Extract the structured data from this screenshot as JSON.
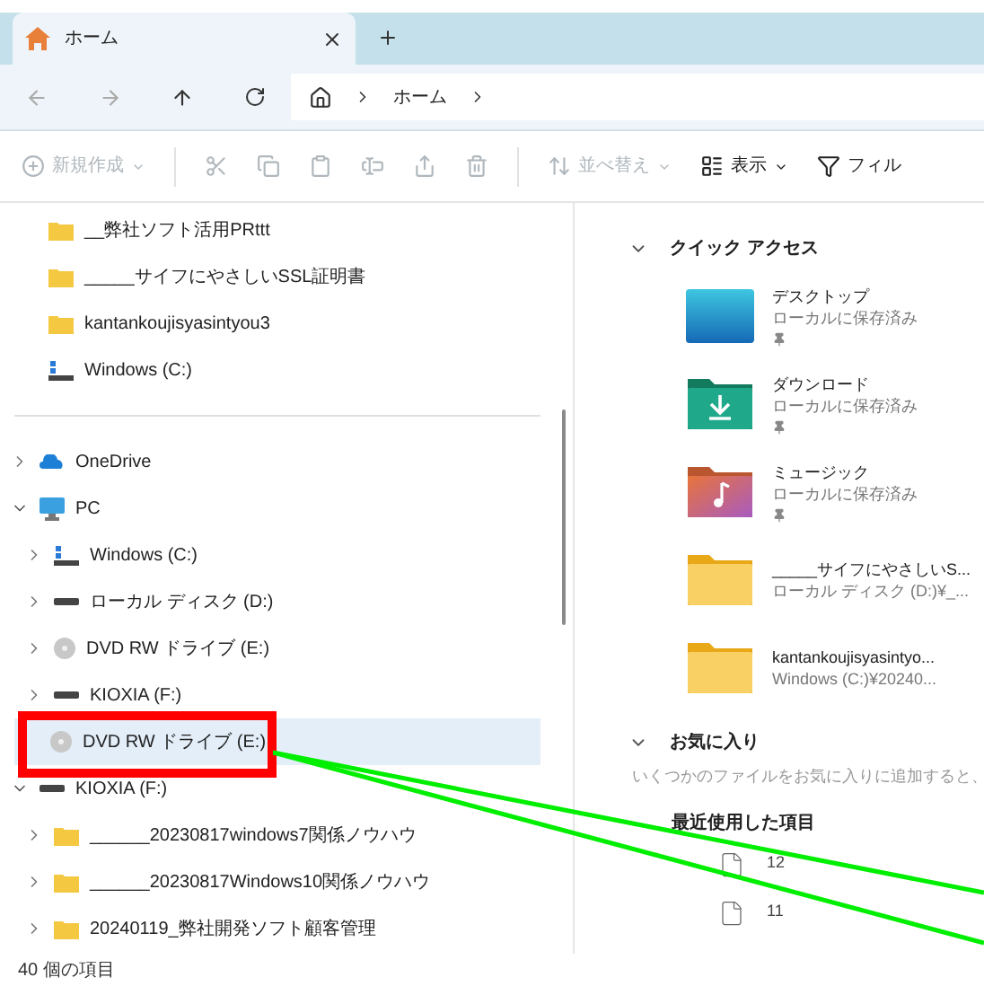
{
  "tabs": [
    {
      "label": "ホーム",
      "selected": true
    }
  ],
  "address": {
    "crumbs": [
      "ホーム"
    ]
  },
  "toolbar": [
    {
      "kind": "new",
      "label": "新規作成",
      "disabled": true
    },
    {
      "kind": "cut",
      "disabled": true
    },
    {
      "kind": "copy",
      "disabled": true
    },
    {
      "kind": "paste",
      "disabled": true
    },
    {
      "kind": "rename",
      "disabled": true
    },
    {
      "kind": "share",
      "disabled": true
    },
    {
      "kind": "delete",
      "disabled": true
    },
    {
      "kind": "sort",
      "label": "並べ替え",
      "disabled": true
    },
    {
      "kind": "view",
      "label": "表示",
      "disabled": false
    },
    {
      "kind": "filter",
      "label": "フィル",
      "disabled": false
    }
  ],
  "nav_pinned": [
    {
      "kind": "folder",
      "label": "__弊社ソフト活用PRttt"
    },
    {
      "kind": "folder",
      "label": "_____サイフにやさしいSSL証明書"
    },
    {
      "kind": "folder",
      "label": "kantankoujisyasintyou3"
    },
    {
      "kind": "windrive",
      "label": "Windows (C:)"
    }
  ],
  "nav_tree": [
    {
      "kind": "cloud",
      "label": "OneDrive",
      "expanded": false,
      "selected": false
    },
    {
      "kind": "pc",
      "label": "PC",
      "expanded": true,
      "selected": false,
      "children": [
        {
          "kind": "windrive",
          "label": "Windows (C:)",
          "expanded": false,
          "selected": false
        },
        {
          "kind": "disk",
          "label": "ローカル ディスク (D:)",
          "expanded": false,
          "selected": false
        },
        {
          "kind": "dvd",
          "label": "DVD RW ドライブ (E:)",
          "expanded": false,
          "selected": false
        },
        {
          "kind": "disk",
          "label": "KIOXIA (F:)",
          "expanded": false,
          "selected": false
        }
      ]
    },
    {
      "kind": "dvd",
      "label": "DVD RW ドライブ (E:)",
      "expanded": false,
      "selected": true
    },
    {
      "kind": "disk",
      "label": "KIOXIA (F:)",
      "expanded": true,
      "selected": false,
      "children": [
        {
          "kind": "folder",
          "label": "______20230817windows7関係ノウハウ",
          "expanded": false,
          "selected": false
        },
        {
          "kind": "folder",
          "label": "______20230817Windows10関係ノウハウ",
          "expanded": false,
          "selected": false
        },
        {
          "kind": "folder",
          "label": "20240119_弊社開発ソフト顧客管理",
          "expanded": false,
          "selected": false
        }
      ]
    }
  ],
  "quick_access": {
    "title": "クイック アクセス",
    "expanded": true,
    "items": [
      {
        "kind": "desktop",
        "name": "デスクトップ",
        "detail": "ローカルに保存済み",
        "pinned": true
      },
      {
        "kind": "download",
        "name": "ダウンロード",
        "detail": "ローカルに保存済み",
        "pinned": true
      },
      {
        "kind": "music",
        "name": "ミュージック",
        "detail": "ローカルに保存済み",
        "pinned": true
      },
      {
        "kind": "folder",
        "name": "_____サイフにやさしいS...",
        "detail": "ローカル ディスク (D:)¥_...",
        "pinned": false
      },
      {
        "kind": "folder",
        "name": "kantankoujisyasintyo...",
        "detail": "Windows (C:)¥20240...",
        "pinned": false
      }
    ]
  },
  "favorites": {
    "title": "お気に入り",
    "expanded": true,
    "message": "いくつかのファイルをお気に入りに追加すると、"
  },
  "recent": {
    "title": "最近使用した項目",
    "files": [
      "12",
      "11"
    ]
  },
  "status_bar": {
    "count": "40 個の項目"
  }
}
